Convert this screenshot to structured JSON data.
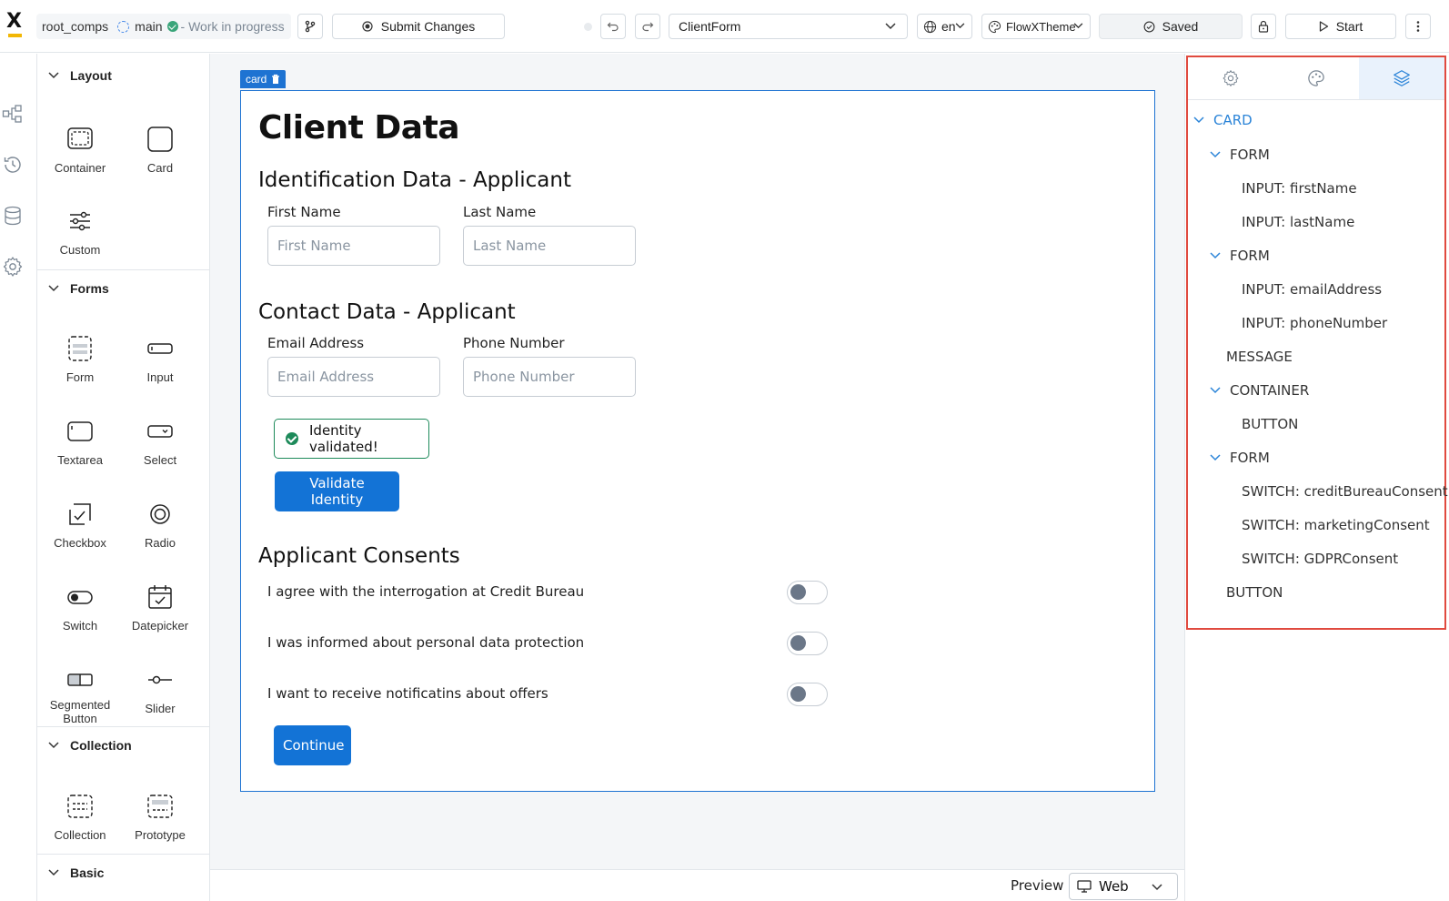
{
  "topbar": {
    "project": "root_comps",
    "branch": "main",
    "status": "- Work in progress",
    "submit_label": "Submit Changes",
    "form_select": "ClientForm",
    "language": "en",
    "theme": "FlowXTheme",
    "saved_label": "Saved",
    "start_label": "Start"
  },
  "palette": {
    "sections": {
      "layout": "Layout",
      "forms": "Forms",
      "collection": "Collection",
      "basic": "Basic"
    },
    "items": {
      "container": "Container",
      "card": "Card",
      "custom": "Custom",
      "form": "Form",
      "input": "Input",
      "textarea": "Textarea",
      "select": "Select",
      "checkbox": "Checkbox",
      "radio": "Radio",
      "switch": "Switch",
      "datepicker": "Datepicker",
      "segmented_1": "Segmented",
      "segmented_2": "Button",
      "slider": "Slider",
      "collection": "Collection",
      "prototype": "Prototype"
    }
  },
  "canvas": {
    "card_tag": "card",
    "title": "Client Data",
    "section1": "Identification Data - Applicant",
    "first_name_label": "First Name",
    "first_name_placeholder": "First Name",
    "last_name_label": "Last Name",
    "last_name_placeholder": "Last Name",
    "section2": "Contact Data - Applicant",
    "email_label": "Email Address",
    "email_placeholder": "Email Address",
    "phone_label": "Phone Number",
    "phone_placeholder": "Phone Number",
    "message": "Identity validated!",
    "validate_button": "Validate Identity",
    "section3": "Applicant Consents",
    "consents": [
      "I agree with the interrogation at Credit Bureau",
      "I was informed about personal data protection",
      "I want to receive notificatins about offers"
    ],
    "continue_button": "Continue"
  },
  "preview": {
    "label": "Preview",
    "mode": "Web"
  },
  "tree": [
    "CARD",
    "FORM",
    "INPUT: firstName",
    "INPUT: lastName",
    "FORM",
    "INPUT: emailAddress",
    "INPUT: phoneNumber",
    "MESSAGE",
    "CONTAINER",
    "BUTTON",
    "FORM",
    "SWITCH: creditBureauConsent",
    "SWITCH: marketingConsent",
    "SWITCH: GDPRConsent",
    "BUTTON"
  ],
  "colors": {
    "accent": "#1373d6",
    "success": "#1d8a5a",
    "highlight_frame": "#e04a3f",
    "logo_bar": "#f2b705"
  },
  "consent_switches": [
    false,
    false,
    false
  ]
}
